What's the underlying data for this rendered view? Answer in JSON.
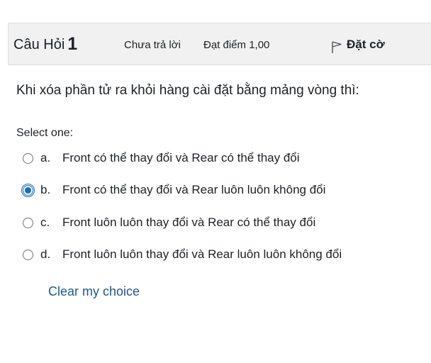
{
  "question_info": {
    "title_label": "Câu Hỏi",
    "number": "1",
    "state": "Chưa trả lời",
    "grade": "Đạt điểm 1,00",
    "flag_icon": "flag-outline-icon",
    "flag_label": "Đặt cờ"
  },
  "question": {
    "text": "Khi xóa phần tử ra khỏi hàng cài đặt bằng mảng vòng thì:",
    "prompt": "Select one:",
    "options": [
      {
        "letter": "a.",
        "text": "Front có thể thay đổi và Rear có thể thay đổi",
        "selected": false
      },
      {
        "letter": "b.",
        "text": "Front có thể thay đổi và Rear luôn luôn không đổi",
        "selected": true
      },
      {
        "letter": "c.",
        "text": "Front luôn luôn thay đổi và Rear có thể thay đổi",
        "selected": false
      },
      {
        "letter": "d.",
        "text": "Front luôn luôn thay đổi và Rear luôn luôn không đổi",
        "selected": false
      }
    ],
    "clear_label": "Clear my choice"
  },
  "colors": {
    "info_bar_bg": "#f1f1f1",
    "accent": "#0f6cbf",
    "link": "#1f5794"
  }
}
